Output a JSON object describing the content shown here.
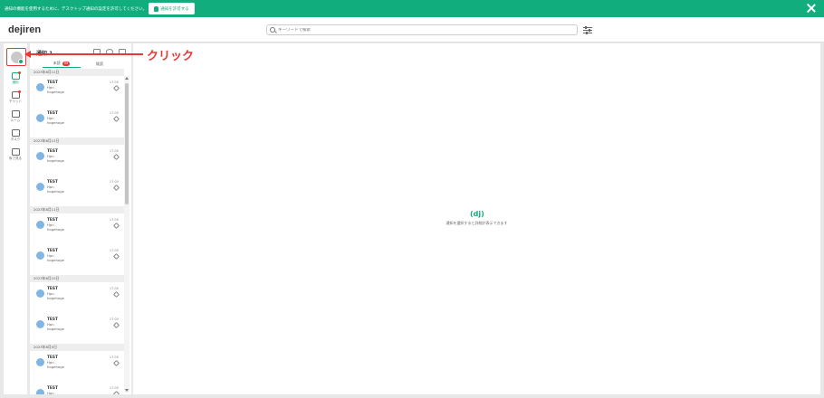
{
  "banner": {
    "text": "通知の機能を使用するために、デスクトップ通知の設定を許可してください。",
    "button_label": "通知を許可する"
  },
  "header": {
    "logo": "dejiren",
    "search_placeholder": "キーワードで検索"
  },
  "rail": {
    "items": [
      {
        "label": "通知",
        "active": true
      },
      {
        "label": "チャット"
      },
      {
        "label": "ルーム"
      },
      {
        "label": "タスク"
      },
      {
        "label": "後で見る"
      }
    ]
  },
  "panel": {
    "title": "通知 1",
    "tabs": [
      {
        "label": "未読",
        "badge": "99"
      },
      {
        "label": "既読"
      }
    ],
    "groups": [
      {
        "date": "2023年8月12日",
        "items": [
          {
            "title": "TEST",
            "sub": "Hpn",
            "body": "hogehoge",
            "time": "17:00"
          },
          {
            "title": "TEST",
            "sub": "Hpn",
            "body": "hogehoge",
            "time": "17:00"
          }
        ]
      },
      {
        "date": "2023年8月12日",
        "items": [
          {
            "title": "TEST",
            "sub": "Hpn",
            "body": "hogehoge",
            "time": "17:00"
          },
          {
            "title": "TEST",
            "sub": "Hpn",
            "body": "hogehoge",
            "time": "17:00"
          }
        ]
      },
      {
        "date": "2023年8月11日",
        "items": [
          {
            "title": "TEST",
            "sub": "Hpn",
            "body": "hogehoge",
            "time": "17:00"
          },
          {
            "title": "TEST",
            "sub": "Hpn",
            "body": "hogehoge",
            "time": "17:00"
          }
        ]
      },
      {
        "date": "2023年8月10日",
        "items": [
          {
            "title": "TEST",
            "sub": "Hpn",
            "body": "hogehoge",
            "time": "17:00"
          },
          {
            "title": "TEST",
            "sub": "Hpn",
            "body": "hogehoge",
            "time": "17:00"
          }
        ]
      },
      {
        "date": "2023年8月9日",
        "items": [
          {
            "title": "TEST",
            "sub": "Hpn",
            "body": "hogehoge",
            "time": "17:00"
          },
          {
            "title": "TEST",
            "sub": "Hpn",
            "body": "hogehoge",
            "time": "17:00"
          }
        ]
      }
    ]
  },
  "detail": {
    "logo": "(dj)",
    "empty_text": "通知を選択すると詳細が表示できます"
  },
  "callout": {
    "text": "クリック"
  },
  "colors": {
    "brand": "#12ad7c",
    "accent_red": "#e53935"
  }
}
